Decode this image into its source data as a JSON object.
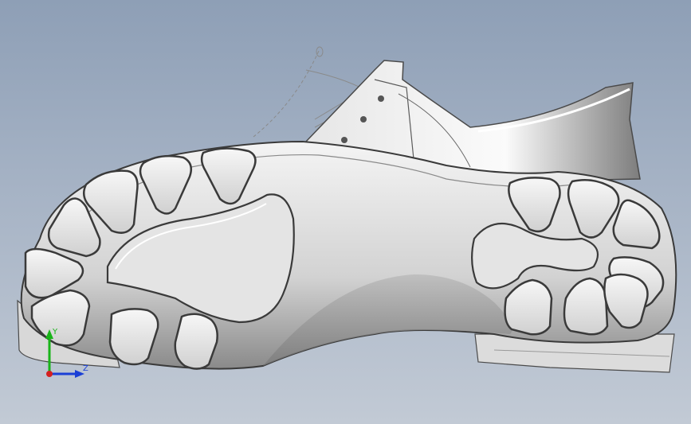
{
  "viewport": {
    "background_top": "#8e9fb6",
    "background_bottom": "#c2cad5"
  },
  "model": {
    "subject": "shoe-sole-3d-model",
    "shading": "grey"
  },
  "triad": {
    "x_label": "",
    "y_label": "Y",
    "z_label": "Z",
    "colors": {
      "x": "#d42020",
      "y": "#18b418",
      "z": "#1a3fd6"
    }
  }
}
